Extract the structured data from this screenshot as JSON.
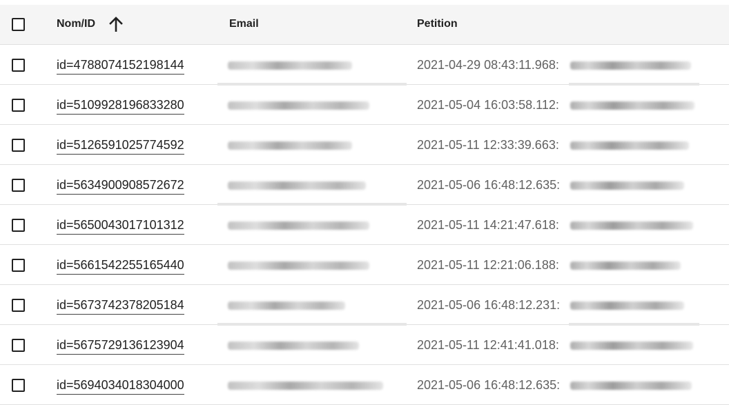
{
  "columns": {
    "name_id": "Nom/ID",
    "email": "Email",
    "petition": "Petition"
  },
  "sort_icon": "arrow-up-icon",
  "rows": [
    {
      "id_label": "id=4788074152198144",
      "petition": "2021-04-29 08:43:11.968:"
    },
    {
      "id_label": "id=5109928196833280",
      "petition": "2021-05-04 16:03:58.112:"
    },
    {
      "id_label": "id=5126591025774592",
      "petition": "2021-05-11 12:33:39.663:"
    },
    {
      "id_label": "id=5634900908572672",
      "petition": "2021-05-06 16:48:12.635:"
    },
    {
      "id_label": "id=5650043017101312",
      "petition": "2021-05-11 14:21:47.618:"
    },
    {
      "id_label": "id=5661542255165440",
      "petition": "2021-05-11 12:21:06.188:"
    },
    {
      "id_label": "id=5673742378205184",
      "petition": "2021-05-06 16:48:12.231:"
    },
    {
      "id_label": "id=5675729136123904",
      "petition": "2021-05-11 12:41:41.018:"
    },
    {
      "id_label": "id=5694034018304000",
      "petition": "2021-05-06 16:48:12.635:"
    }
  ]
}
